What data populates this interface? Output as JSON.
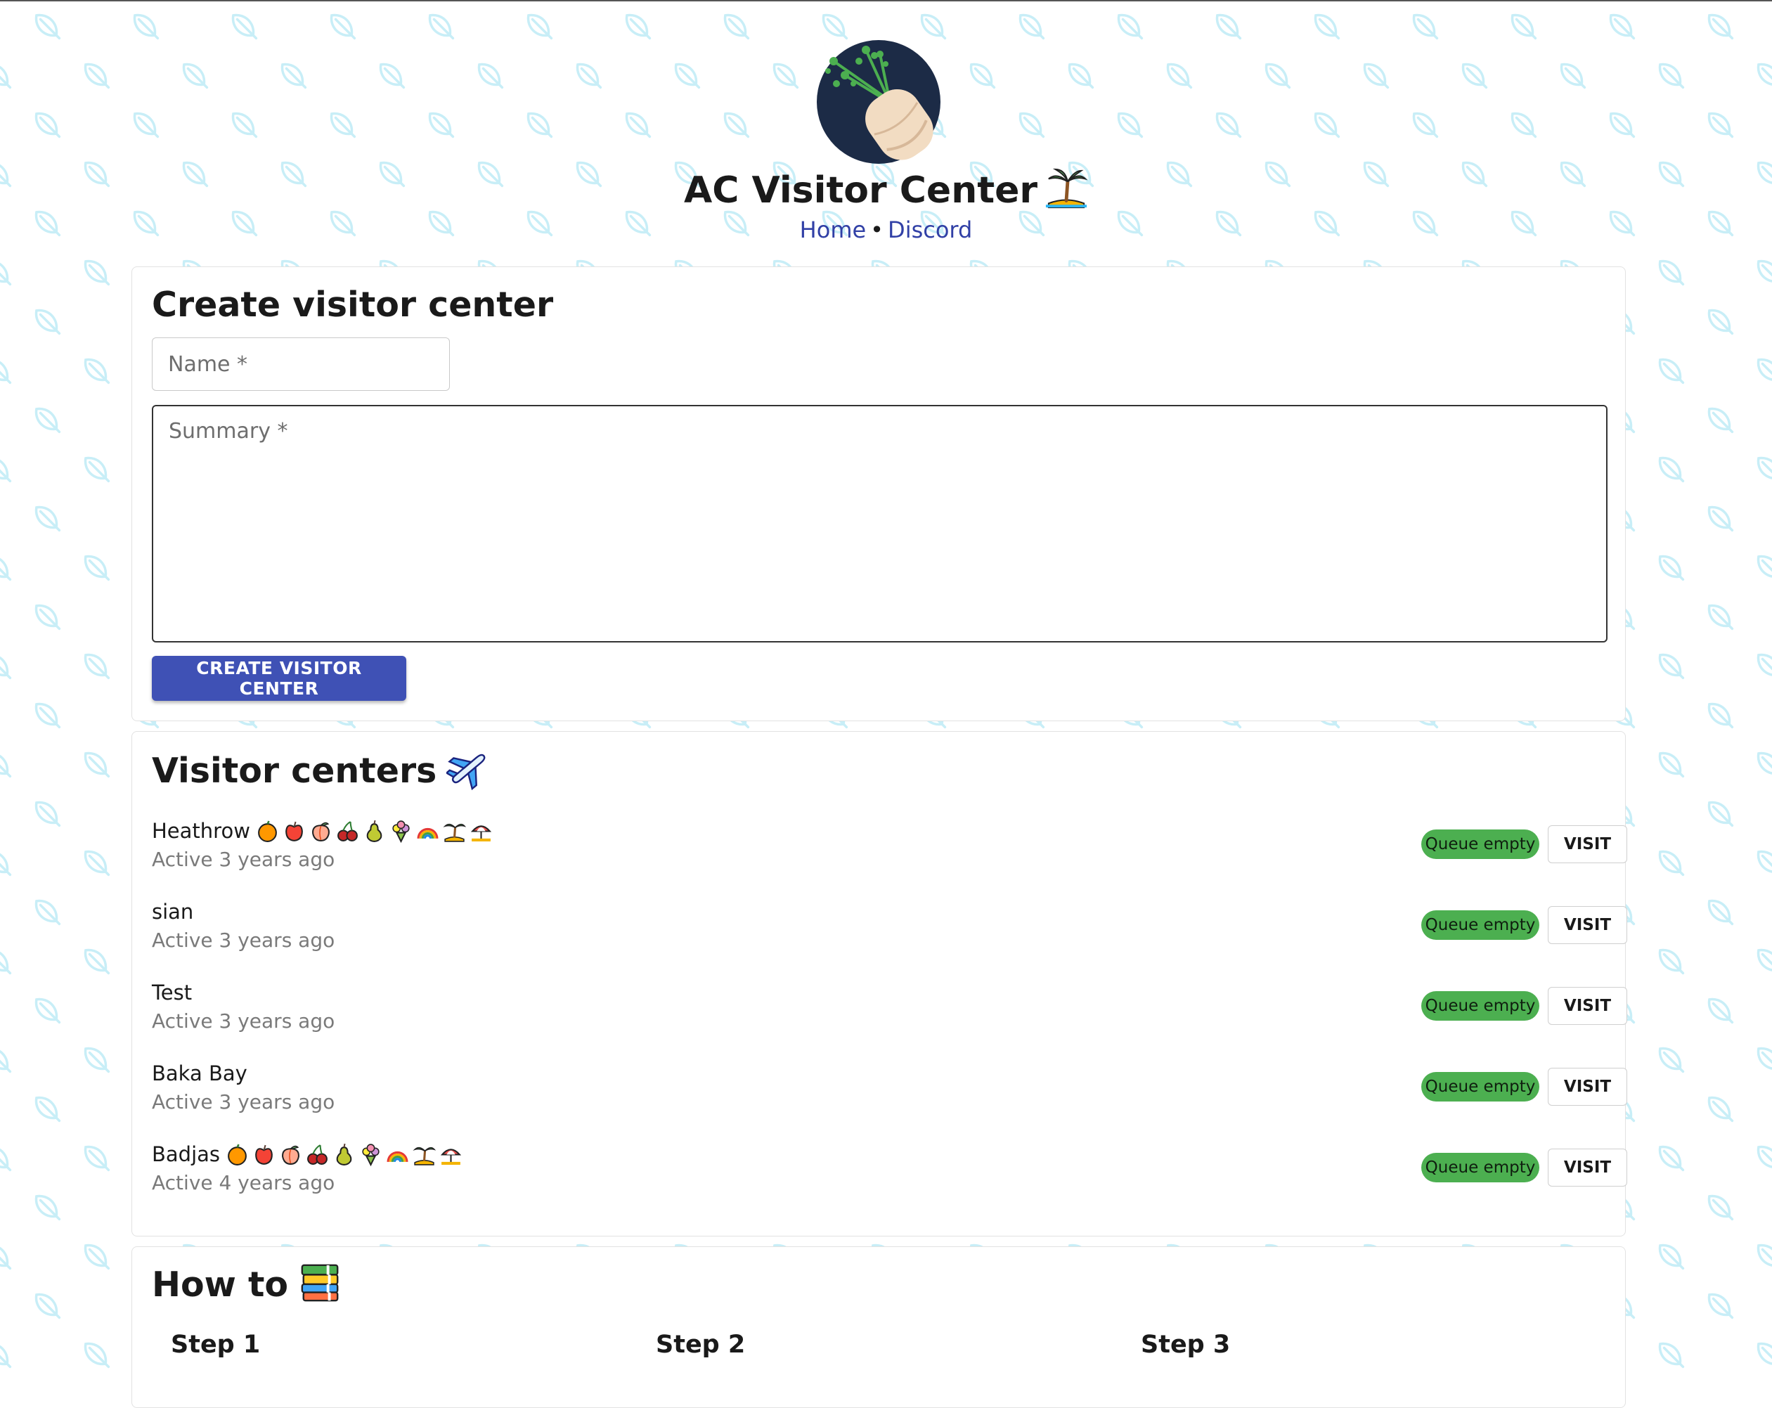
{
  "header": {
    "logo_icon": "turnip-logo-icon",
    "title": "AC Visitor Center",
    "title_icon": "palm-island-icon",
    "nav": {
      "home": "Home",
      "separator": "•",
      "discord": "Discord"
    }
  },
  "create_form": {
    "heading": "Create visitor center",
    "name_placeholder": "Name *",
    "summary_placeholder": "Summary *",
    "submit_label": "CREATE VISITOR CENTER"
  },
  "visitor_centers": {
    "heading": "Visitor centers",
    "heading_icon": "airplane-icon",
    "items": [
      {
        "name": "Heathrow",
        "active": "Active 3 years ago",
        "status": "Queue empty",
        "visit_label": "VISIT",
        "has_fruit_icons": true
      },
      {
        "name": "sian",
        "active": "Active 3 years ago",
        "status": "Queue empty",
        "visit_label": "VISIT",
        "has_fruit_icons": false
      },
      {
        "name": "Test",
        "active": "Active 3 years ago",
        "status": "Queue empty",
        "visit_label": "VISIT",
        "has_fruit_icons": false
      },
      {
        "name": "Baka Bay",
        "active": "Active 3 years ago",
        "status": "Queue empty",
        "visit_label": "VISIT",
        "has_fruit_icons": false
      },
      {
        "name": "Badjas",
        "active": "Active 4 years ago",
        "status": "Queue empty",
        "visit_label": "VISIT",
        "has_fruit_icons": true
      }
    ],
    "fruit_icons": [
      "orange-icon",
      "apple-icon",
      "peach-icon",
      "cherries-icon",
      "pear-icon",
      "flower-bouquet-icon",
      "rainbow-icon",
      "palm-island-icon",
      "beach-umbrella-icon"
    ]
  },
  "how_to": {
    "heading": "How to",
    "heading_icon": "books-icon",
    "steps": [
      "Step 1",
      "Step 2",
      "Step 3"
    ]
  },
  "colors": {
    "primary": "#3f51b5",
    "link": "#3140a6",
    "badge": "#4caf50",
    "pattern": "#c8eef7",
    "logo_bg": "#1c2b46"
  }
}
